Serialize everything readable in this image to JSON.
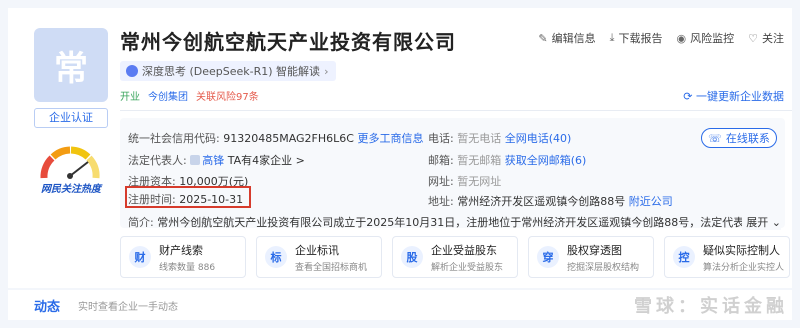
{
  "company": {
    "logo_char": "常",
    "name": "常州今创航空航天产业投资有限公司",
    "certification_label": "企业认证",
    "hot_label": "网民关注热度",
    "ai_pill": "深度思考 (DeepSeek-R1) 智能解读",
    "tags": {
      "open": "开业",
      "group": "今创集团",
      "risk": "关联风险97条"
    }
  },
  "actions": {
    "edit": "编辑信息",
    "download": "下载报告",
    "monitor": "风险监控",
    "follow": "关注",
    "refresh": "一键更新企业数据"
  },
  "info": {
    "credit_code_label": "统一社会信用代码:",
    "credit_code_value": "91320485MAG2FH6L6C",
    "more_business": "更多工商信息",
    "phone_label": "电话:",
    "phone_value": "暂无电话",
    "phone_link": "全网电话(40)",
    "online_service": "在线联系",
    "legal_label": "法定代表人:",
    "legal_name": "高锋",
    "legal_extra": "TA有4家企业 >",
    "email_label": "邮箱:",
    "email_value": "暂无邮箱",
    "email_link": "获取全网邮箱(6)",
    "capital_label": "注册资本:",
    "capital_value": "10,000万(元)",
    "website_label": "网址:",
    "website_value": "暂无网址",
    "reg_time_label": "注册时间:",
    "reg_time_value": "2025-10-31",
    "address_label": "地址:",
    "address_value": "常州经济开发区遥观镇今创路88号",
    "address_link": "附近公司",
    "intro_label": "简介:",
    "intro_value": "常州今创航空航天产业投资有限公司成立于2025年10月31日，注册地位于常州经济开发区遥观镇今创路88号，法定代表人为高锋。经营范围",
    "expand": "展开"
  },
  "features": [
    {
      "icon": "财",
      "title": "财产线索",
      "sub": "线索数量 886"
    },
    {
      "icon": "标",
      "title": "企业标讯",
      "sub": "查看全国招标商机"
    },
    {
      "icon": "股",
      "title": "企业受益股东",
      "sub": "解析企业受益股东"
    },
    {
      "icon": "穿",
      "title": "股权穿透图",
      "sub": "挖掘深层股权结构"
    },
    {
      "icon": "控",
      "title": "疑似实际控制人",
      "sub": "算法分析企业实控人"
    }
  ],
  "dynamic": {
    "title": "动态",
    "sub": "实时查看企业一手动态"
  },
  "watermark": "雪球：实话金融"
}
